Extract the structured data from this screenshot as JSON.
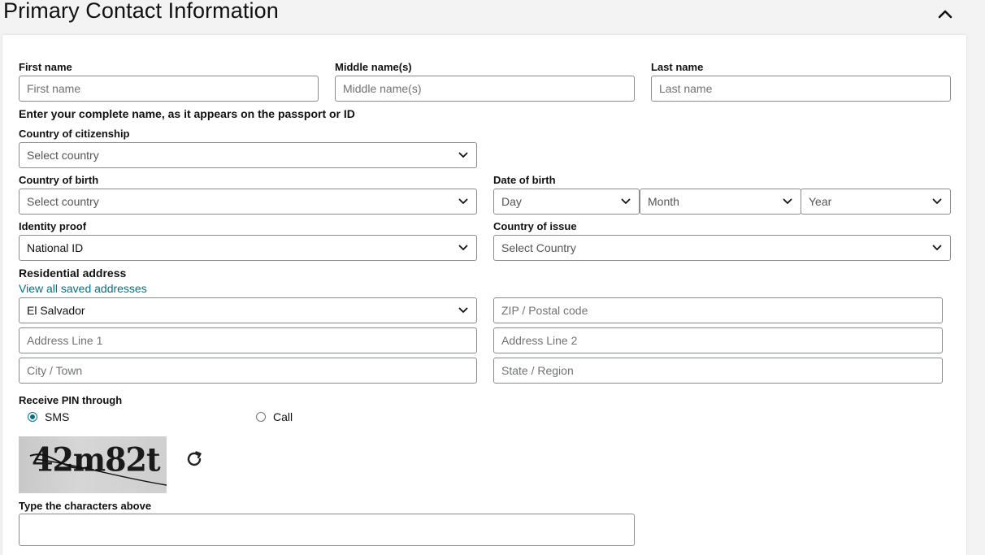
{
  "section": {
    "title": "Primary Contact Information"
  },
  "name": {
    "first_label": "First name",
    "first_placeholder": "First name",
    "middle_label": "Middle name(s)",
    "middle_placeholder": "Middle name(s)",
    "last_label": "Last name",
    "last_placeholder": "Last name",
    "hint": "Enter your complete name, as it appears on the passport or ID"
  },
  "citizenship": {
    "label": "Country of citizenship",
    "value": "Select country"
  },
  "birth_country": {
    "label": "Country of birth",
    "value": "Select country"
  },
  "dob": {
    "label": "Date of birth",
    "day": "Day",
    "month": "Month",
    "year": "Year"
  },
  "identity": {
    "label": "Identity proof",
    "value": "National ID"
  },
  "issue_country": {
    "label": "Country of issue",
    "value": "Select Country"
  },
  "address": {
    "label": "Residential address",
    "saved_link": "View all saved addresses",
    "country": "El Salvador",
    "zip_placeholder": "ZIP / Postal code",
    "line1_placeholder": "Address Line 1",
    "line2_placeholder": "Address Line 2",
    "city_placeholder": "City / Town",
    "state_placeholder": "State / Region"
  },
  "pin": {
    "label": "Receive PIN through",
    "options": [
      {
        "label": "SMS",
        "selected": true
      },
      {
        "label": "Call",
        "selected": false
      }
    ]
  },
  "captcha": {
    "text": "42m82t",
    "input_label": "Type the characters above"
  },
  "colors": {
    "accent": "#007185",
    "border": "#888c8c"
  },
  "icons": {
    "collapse": "chevron-up-icon",
    "dropdown": "chevron-down-icon",
    "refresh": "refresh-icon"
  }
}
